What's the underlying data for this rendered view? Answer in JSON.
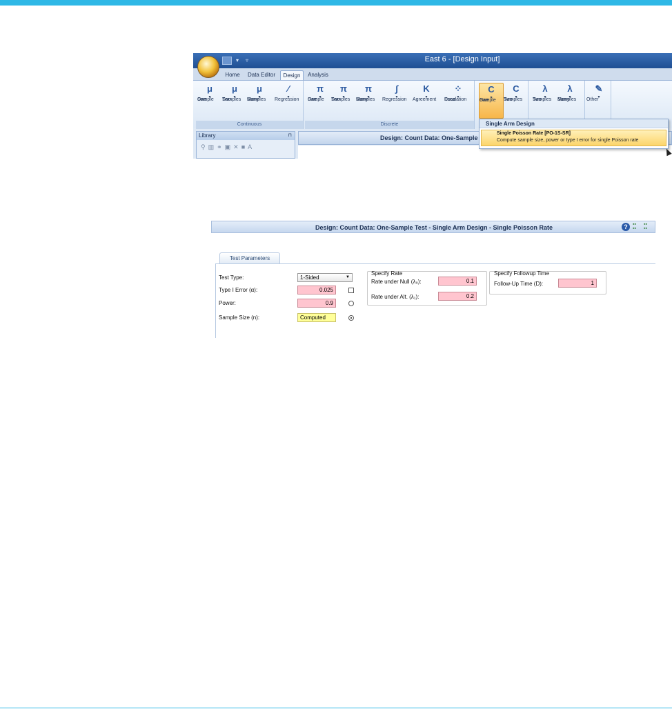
{
  "app": {
    "window_title": "East 6 - [Design Input]",
    "tabs": [
      "Home",
      "Data Editor",
      "Design",
      "Analysis"
    ],
    "active_tab": "Design"
  },
  "ribbon": {
    "continuous": {
      "label": "Continuous",
      "buttons": [
        {
          "line1": "One",
          "line2": "Sample"
        },
        {
          "line1": "Two",
          "line2": "Samples"
        },
        {
          "line1": "Many",
          "line2": "Samples"
        },
        {
          "line1": "Regression",
          "line2": ""
        }
      ]
    },
    "discrete": {
      "label": "Discrete",
      "buttons": [
        {
          "line1": "One",
          "line2": "Sample"
        },
        {
          "line1": "Two",
          "line2": "Samples"
        },
        {
          "line1": "Many",
          "line2": "Samples"
        },
        {
          "line1": "Regression",
          "line2": ""
        },
        {
          "line1": "Agreement",
          "line2": ""
        },
        {
          "line1": "Dose",
          "line2": "Escalation"
        }
      ]
    },
    "count": {
      "buttons": [
        {
          "line1": "One",
          "line2": "Sample"
        },
        {
          "line1": "Two",
          "line2": "Samples"
        }
      ]
    },
    "survival": {
      "buttons": [
        {
          "line1": "Two",
          "line2": "Samples"
        },
        {
          "line1": "Many",
          "line2": "Samples"
        }
      ]
    },
    "other": {
      "line1": "Other",
      "line2": ""
    }
  },
  "dropdown": {
    "header": "Single Arm Design",
    "item_title": "Single Poisson Rate [PO-1S-SR]",
    "item_desc": "Compute sample size, power or type I error for single Poisson rate"
  },
  "library": {
    "title": "Library"
  },
  "design_bar_title": "Design: Count Data: One-Sample",
  "design_input": {
    "title": "Design: Count Data: One-Sample Test - Single Arm Design - Single Poisson Rate",
    "tab": "Test Parameters",
    "test_type_label": "Test Type:",
    "test_type_value": "1-Sided",
    "type1_label": "Type I Error (α):",
    "type1_value": "0.025",
    "power_label": "Power:",
    "power_value": "0.9",
    "sample_size_label": "Sample Size (n):",
    "sample_size_value": "Computed",
    "rate_box_title": "Specify Rate",
    "null_rate_label": "Rate under Null (λ₀):",
    "null_rate_value": "0.1",
    "alt_rate_label": "Rate under Alt. (λ₁):",
    "alt_rate_value": "0.2",
    "followup_box_title": "Specify Followup Time",
    "followup_label": "Follow-Up Time (D):",
    "followup_value": "1"
  }
}
